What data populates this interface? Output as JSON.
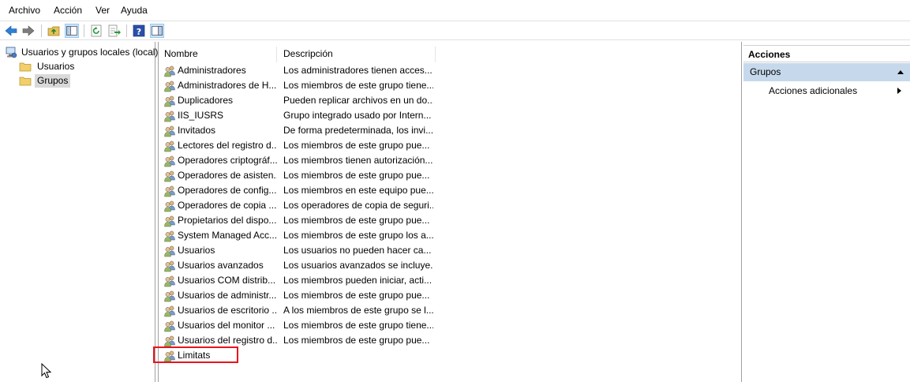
{
  "menu": [
    "Archivo",
    "Acción",
    "Ver",
    "Ayuda"
  ],
  "tree": {
    "root": "Usuarios y grupos locales (local)",
    "children": [
      {
        "label": "Usuarios",
        "selected": false
      },
      {
        "label": "Grupos",
        "selected": true
      }
    ]
  },
  "list": {
    "columns": [
      "Nombre",
      "Descripción"
    ],
    "rows": [
      {
        "name": "Administradores",
        "desc": "Los administradores tienen acces..."
      },
      {
        "name": "Administradores de H...",
        "desc": "Los miembros de este grupo tiene..."
      },
      {
        "name": "Duplicadores",
        "desc": "Pueden replicar archivos en un do..."
      },
      {
        "name": "IIS_IUSRS",
        "desc": "Grupo integrado usado por Intern..."
      },
      {
        "name": "Invitados",
        "desc": "De forma predeterminada, los invi..."
      },
      {
        "name": "Lectores del registro d...",
        "desc": "Los miembros de este grupo pue..."
      },
      {
        "name": "Operadores criptográf...",
        "desc": "Los miembros tienen autorización..."
      },
      {
        "name": "Operadores de asisten...",
        "desc": "Los miembros de este grupo pue..."
      },
      {
        "name": "Operadores de config...",
        "desc": "Los miembros en este equipo pue..."
      },
      {
        "name": "Operadores de copia ...",
        "desc": "Los operadores de copia de seguri..."
      },
      {
        "name": "Propietarios del dispo...",
        "desc": "Los miembros de este grupo pue..."
      },
      {
        "name": "System Managed Acc...",
        "desc": "Los miembros de este grupo los a..."
      },
      {
        "name": "Usuarios",
        "desc": "Los usuarios no pueden hacer ca..."
      },
      {
        "name": "Usuarios avanzados",
        "desc": "Los usuarios avanzados se incluye..."
      },
      {
        "name": "Usuarios COM distrib...",
        "desc": "Los miembros pueden iniciar, acti..."
      },
      {
        "name": "Usuarios de administr...",
        "desc": "Los miembros de este grupo pue..."
      },
      {
        "name": "Usuarios de escritorio ...",
        "desc": "A los miembros de este grupo se l..."
      },
      {
        "name": "Usuarios del monitor ...",
        "desc": "Los miembros de este grupo tiene..."
      },
      {
        "name": "Usuarios del registro d...",
        "desc": "Los miembros de este grupo pue..."
      },
      {
        "name": "Limitats",
        "desc": ""
      }
    ]
  },
  "actions": {
    "title": "Acciones",
    "section": "Grupos",
    "item": "Acciones adicionales"
  },
  "colors": {
    "highlight_box": "#e8141c",
    "actions_section_bg": "#c6d9ec",
    "selected_tree_bg": "#d9d9d9"
  },
  "icons": [
    "back-arrow-icon",
    "forward-arrow-icon",
    "up-folder-icon",
    "show-hide-tree-icon",
    "refresh-icon",
    "export-list-icon",
    "help-icon",
    "show-hide-action-pane-icon",
    "computer-icon",
    "folder-icon",
    "group-icon"
  ]
}
